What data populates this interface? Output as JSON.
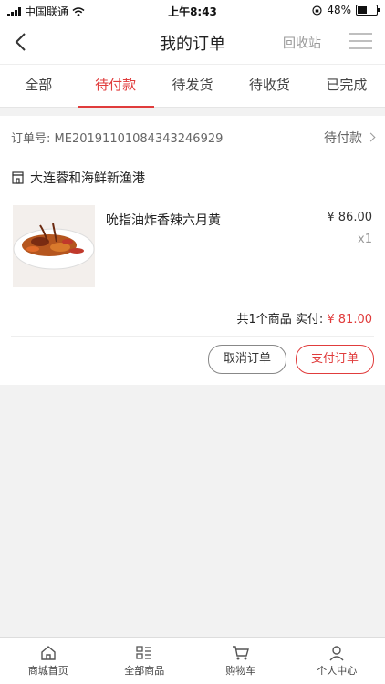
{
  "status_bar": {
    "carrier": "中国联通",
    "time": "上午8:43",
    "battery": "48%",
    "battery_level": 0.48
  },
  "header": {
    "title": "我的订单",
    "recycle_label": "回收站"
  },
  "tabs": [
    {
      "label": "全部",
      "active": false
    },
    {
      "label": "待付款",
      "active": true
    },
    {
      "label": "待发货",
      "active": false
    },
    {
      "label": "待收货",
      "active": false
    },
    {
      "label": "已完成",
      "active": false
    }
  ],
  "order": {
    "number_label": "订单号:",
    "number": "ME20191101084343246929",
    "status": "待付款",
    "store": "大连蓉和海鲜新渔港",
    "item": {
      "name": "吮指油炸香辣六月黄",
      "price": "¥ 86.00",
      "qty": "x1"
    },
    "summary_label": "共1个商品 实付:",
    "paid": "¥ 81.00",
    "cancel_label": "取消订单",
    "pay_label": "支付订单"
  },
  "bottom_nav": [
    {
      "label": "商城首页",
      "icon": "home-icon"
    },
    {
      "label": "全部商品",
      "icon": "grid-list-icon"
    },
    {
      "label": "购物车",
      "icon": "cart-icon"
    },
    {
      "label": "个人中心",
      "icon": "user-icon"
    }
  ],
  "colors": {
    "accent": "#e03c3c",
    "background": "#f2f2f2"
  }
}
